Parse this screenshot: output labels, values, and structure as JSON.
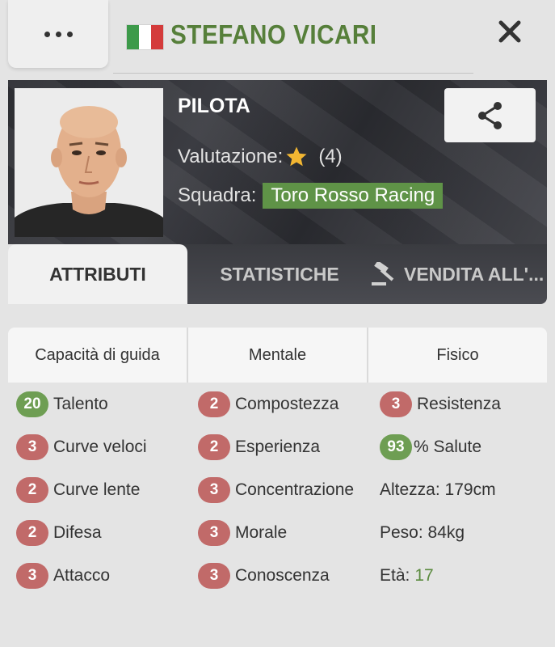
{
  "header": {
    "player_name": "STEFANO VICARI",
    "flag_colors": [
      "#3d9a4a",
      "#ffffff",
      "#d43b3b"
    ]
  },
  "card": {
    "role": "PILOTA",
    "rating_label": "Valutazione:",
    "rating_value": "(4)",
    "team_label": "Squadra:",
    "team_name": "Toro Rosso Racing"
  },
  "tabs": [
    {
      "label": "ATTRIBUTI",
      "active": true
    },
    {
      "label": "STATISTICHE",
      "active": false
    },
    {
      "label": "VENDITA ALL'...",
      "active": false,
      "icon": "gavel-icon"
    }
  ],
  "attributes": {
    "headers": [
      "Capacità di guida",
      "Mentale",
      "Fisico"
    ],
    "driving": [
      {
        "value": "20",
        "label": "Talento",
        "color": "green"
      },
      {
        "value": "3",
        "label": "Curve veloci",
        "color": "red"
      },
      {
        "value": "2",
        "label": "Curve lente",
        "color": "red"
      },
      {
        "value": "2",
        "label": "Difesa",
        "color": "red"
      },
      {
        "value": "3",
        "label": "Attacco",
        "color": "red"
      }
    ],
    "mental": [
      {
        "value": "2",
        "label": "Compostezza",
        "color": "red"
      },
      {
        "value": "2",
        "label": "Esperienza",
        "color": "red"
      },
      {
        "value": "3",
        "label": "Concentrazione",
        "color": "red"
      },
      {
        "value": "3",
        "label": "Morale",
        "color": "red"
      },
      {
        "value": "3",
        "label": "Conoscenza",
        "color": "red"
      }
    ],
    "physical": {
      "stamina_value": "3",
      "stamina_label": "Resistenza",
      "health_value": "93",
      "health_label": "% Salute",
      "height_text": "Altezza: 179cm",
      "weight_text": "Peso: 84kg",
      "age_label": "Età:",
      "age_value": "17"
    }
  },
  "colors": {
    "accent_green": "#567f3a",
    "badge_red": "#c16a69",
    "badge_green": "#6e9e53",
    "team_badge": "#5f9347"
  }
}
